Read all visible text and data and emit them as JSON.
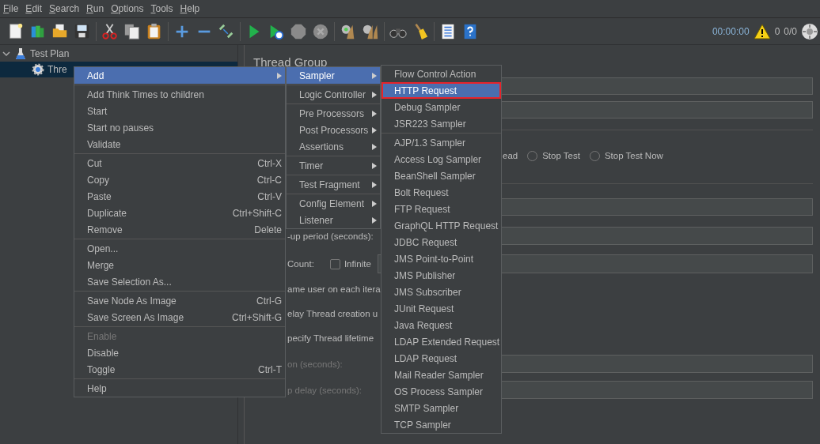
{
  "menubar": [
    {
      "label": "File"
    },
    {
      "label": "Edit"
    },
    {
      "label": "Search"
    },
    {
      "label": "Run"
    },
    {
      "label": "Options"
    },
    {
      "label": "Tools"
    },
    {
      "label": "Help"
    }
  ],
  "status": {
    "elapsed": "00:00:00",
    "warnings": "0",
    "threads": "0/0"
  },
  "tree": [
    {
      "label": "Test Plan",
      "expanded": true,
      "selected": false,
      "children": [
        {
          "label": "Thre",
          "selected": true
        }
      ]
    }
  ],
  "form": {
    "title": "Thread Group",
    "rows": [
      {
        "kind": "field"
      },
      {
        "kind": "field"
      },
      {
        "kind": "rule"
      },
      {
        "kind": "radios",
        "lead_text": "ead",
        "options": [
          {
            "label": "Stop Test",
            "selected": false
          },
          {
            "label": "Stop Test Now",
            "selected": false
          }
        ]
      },
      {
        "kind": "rule"
      },
      {
        "kind": "field"
      },
      {
        "kind": "labeled_field",
        "label": "-up period (seconds):",
        "disabled": false
      },
      {
        "kind": "count",
        "label": "Count:",
        "checkbox": {
          "label": "Infinite",
          "checked": false
        }
      },
      {
        "kind": "text",
        "label": "ame user on each itera"
      },
      {
        "kind": "text",
        "label": "elay Thread creation u"
      },
      {
        "kind": "text",
        "label": "pecify Thread lifetime"
      },
      {
        "kind": "labeled_field",
        "label": "on (seconds):",
        "disabled": true
      },
      {
        "kind": "labeled_field",
        "label": "p delay (seconds):",
        "disabled": true
      }
    ]
  },
  "context_menu": {
    "items": [
      {
        "kind": "submenu",
        "label": "Add",
        "selected": true,
        "disabled": false
      },
      {
        "kind": "separator"
      },
      {
        "kind": "item",
        "label": "Add Think Times to children",
        "selected": false,
        "disabled": false
      },
      {
        "kind": "item",
        "label": "Start",
        "selected": false,
        "disabled": false
      },
      {
        "kind": "item",
        "label": "Start no pauses",
        "selected": false,
        "disabled": false
      },
      {
        "kind": "item",
        "label": "Validate",
        "selected": false,
        "disabled": false
      },
      {
        "kind": "separator"
      },
      {
        "kind": "item",
        "label": "Cut",
        "shortcut": "Ctrl-X",
        "selected": false,
        "disabled": false
      },
      {
        "kind": "item",
        "label": "Copy",
        "shortcut": "Ctrl-C",
        "selected": false,
        "disabled": false
      },
      {
        "kind": "item",
        "label": "Paste",
        "shortcut": "Ctrl-V",
        "selected": false,
        "disabled": false
      },
      {
        "kind": "item",
        "label": "Duplicate",
        "shortcut": "Ctrl+Shift-C",
        "selected": false,
        "disabled": false
      },
      {
        "kind": "item",
        "label": "Remove",
        "shortcut": "Delete",
        "selected": false,
        "disabled": false
      },
      {
        "kind": "separator"
      },
      {
        "kind": "item",
        "label": "Open...",
        "selected": false,
        "disabled": false
      },
      {
        "kind": "item",
        "label": "Merge",
        "selected": false,
        "disabled": false
      },
      {
        "kind": "item",
        "label": "Save Selection As...",
        "selected": false,
        "disabled": false
      },
      {
        "kind": "separator"
      },
      {
        "kind": "item",
        "label": "Save Node As Image",
        "shortcut": "Ctrl-G",
        "selected": false,
        "disabled": false
      },
      {
        "kind": "item",
        "label": "Save Screen As Image",
        "shortcut": "Ctrl+Shift-G",
        "selected": false,
        "disabled": false
      },
      {
        "kind": "separator"
      },
      {
        "kind": "item",
        "label": "Enable",
        "selected": false,
        "disabled": true
      },
      {
        "kind": "item",
        "label": "Disable",
        "selected": false,
        "disabled": false
      },
      {
        "kind": "item",
        "label": "Toggle",
        "shortcut": "Ctrl-T",
        "selected": false,
        "disabled": false
      },
      {
        "kind": "separator"
      },
      {
        "kind": "item",
        "label": "Help",
        "selected": false,
        "disabled": false
      }
    ]
  },
  "add_submenu": {
    "items": [
      {
        "kind": "submenu",
        "label": "Sampler",
        "selected": true
      },
      {
        "kind": "separator"
      },
      {
        "kind": "submenu",
        "label": "Logic Controller",
        "selected": false
      },
      {
        "kind": "separator"
      },
      {
        "kind": "submenu",
        "label": "Pre Processors",
        "selected": false
      },
      {
        "kind": "submenu",
        "label": "Post Processors",
        "selected": false
      },
      {
        "kind": "submenu",
        "label": "Assertions",
        "selected": false
      },
      {
        "kind": "separator"
      },
      {
        "kind": "submenu",
        "label": "Timer",
        "selected": false
      },
      {
        "kind": "separator"
      },
      {
        "kind": "submenu",
        "label": "Test Fragment",
        "selected": false
      },
      {
        "kind": "separator"
      },
      {
        "kind": "submenu",
        "label": "Config Element",
        "selected": false
      },
      {
        "kind": "submenu",
        "label": "Listener",
        "selected": false
      }
    ]
  },
  "sampler_submenu": {
    "items": [
      {
        "kind": "item",
        "label": "Flow Control Action",
        "selected": false,
        "outlined": false
      },
      {
        "kind": "item",
        "label": "HTTP Request",
        "selected": true,
        "outlined": true
      },
      {
        "kind": "item",
        "label": "Debug Sampler",
        "selected": false,
        "outlined": false
      },
      {
        "kind": "item",
        "label": "JSR223 Sampler",
        "selected": false,
        "outlined": false
      },
      {
        "kind": "separator"
      },
      {
        "kind": "item",
        "label": "AJP/1.3 Sampler",
        "selected": false,
        "outlined": false
      },
      {
        "kind": "item",
        "label": "Access Log Sampler",
        "selected": false,
        "outlined": false
      },
      {
        "kind": "item",
        "label": "BeanShell Sampler",
        "selected": false,
        "outlined": false
      },
      {
        "kind": "item",
        "label": "Bolt Request",
        "selected": false,
        "outlined": false
      },
      {
        "kind": "item",
        "label": "FTP Request",
        "selected": false,
        "outlined": false
      },
      {
        "kind": "item",
        "label": "GraphQL HTTP Request",
        "selected": false,
        "outlined": false
      },
      {
        "kind": "item",
        "label": "JDBC Request",
        "selected": false,
        "outlined": false
      },
      {
        "kind": "item",
        "label": "JMS Point-to-Point",
        "selected": false,
        "outlined": false
      },
      {
        "kind": "item",
        "label": "JMS Publisher",
        "selected": false,
        "outlined": false
      },
      {
        "kind": "item",
        "label": "JMS Subscriber",
        "selected": false,
        "outlined": false
      },
      {
        "kind": "item",
        "label": "JUnit Request",
        "selected": false,
        "outlined": false
      },
      {
        "kind": "item",
        "label": "Java Request",
        "selected": false,
        "outlined": false
      },
      {
        "kind": "item",
        "label": "LDAP Extended Request",
        "selected": false,
        "outlined": false
      },
      {
        "kind": "item",
        "label": "LDAP Request",
        "selected": false,
        "outlined": false
      },
      {
        "kind": "item",
        "label": "Mail Reader Sampler",
        "selected": false,
        "outlined": false
      },
      {
        "kind": "item",
        "label": "OS Process Sampler",
        "selected": false,
        "outlined": false
      },
      {
        "kind": "item",
        "label": "SMTP Sampler",
        "selected": false,
        "outlined": false
      },
      {
        "kind": "item",
        "label": "TCP Sampler",
        "selected": false,
        "outlined": false
      }
    ]
  }
}
